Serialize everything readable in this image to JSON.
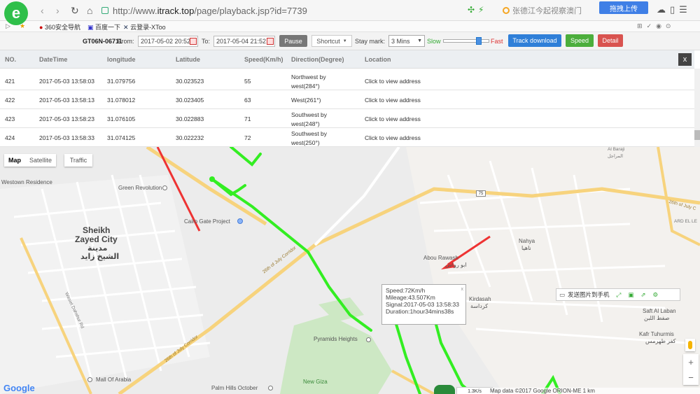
{
  "browser": {
    "logo": "e",
    "url_prefix": "http://www.",
    "url_domain": "itrack.top",
    "url_suffix": "/page/playback.jsp?id=7739",
    "search_text": "张德江今起视察澳门",
    "upload_label": "拖拽上传"
  },
  "bookmarks": [
    {
      "label": "360安全导航"
    },
    {
      "label": "百度一下"
    },
    {
      "label": "云登录-XToo"
    }
  ],
  "toolbar": {
    "device": "GT06N-06711",
    "from_label": "From:",
    "from_value": "2017-05-02 20:52",
    "to_label": "To:",
    "to_value": "2017-05-04 21:52",
    "pause_label": "Pause",
    "shortcut_label": "Shortcut",
    "staymark_label": "Stay mark:",
    "staymark_value": "3 Mins",
    "slow_label": "Slow",
    "fast_label": "Fast",
    "track_download_label": "Track download",
    "speed_label": "Speed",
    "detail_label": "Detail",
    "colors": {
      "track_download": "#2f7fd8",
      "speed": "#4cae3c",
      "detail": "#d9534f"
    }
  },
  "table": {
    "headers": [
      "NO.",
      "DateTime",
      "longitude",
      "Latitude",
      "Speed(Km/h)",
      "Direction(Degree)",
      "Location"
    ],
    "close_label": "x",
    "rows": [
      {
        "no": "421",
        "datetime": "2017-05-03 13:58:03",
        "lng": "31.079756",
        "lat": "30.023523",
        "speed": "55",
        "dir": "Northwest by west(284°)",
        "loc": "Click to view address"
      },
      {
        "no": "422",
        "datetime": "2017-05-03 13:58:13",
        "lng": "31.078012",
        "lat": "30.023405",
        "speed": "63",
        "dir": "West(261°)",
        "loc": "Click to view address"
      },
      {
        "no": "423",
        "datetime": "2017-05-03 13:58:23",
        "lng": "31.076105",
        "lat": "30.022883",
        "speed": "71",
        "dir": "Southwest by west(248°)",
        "loc": "Click to view address"
      },
      {
        "no": "424",
        "datetime": "2017-05-03 13:58:33",
        "lng": "31.074125",
        "lat": "30.022232",
        "speed": "72",
        "dir": "Southwest by west(250°)",
        "loc": "Click to view address"
      }
    ]
  },
  "map": {
    "tabs": {
      "map": "Map",
      "satellite": "Satellite",
      "traffic": "Traffic"
    },
    "labels": {
      "westown": "Westown Residence",
      "green_revolution": "Green Revolution",
      "cairo_gate": "Cairo Gate Project",
      "sheikh1": "Sheikh",
      "sheikh2": "Zayed City",
      "sheikh_ar1": "مدينة",
      "sheikh_ar2": "الشيخ زايد",
      "abou_rawash": "Abou Rawash",
      "abou_rawash_ar": "ابو رواش",
      "nahya": "Nahya",
      "nahya_ar": "ناهيا",
      "kirdasah": "Kirdasah",
      "kirdasah_ar": "كرداسة",
      "pyramids": "Pyramids Heights",
      "mall": "Mall Of Arabia",
      "palm": "Palm Hills October",
      "new_giza": "New Giza",
      "saft": "Saft Al Laban",
      "saft_ar": "صفط اللبن",
      "kafr": "Kafr Tuhurmis",
      "kafr_ar": "كفر طهرمس",
      "ard": "ARD EL LE",
      "al_baraji": "Al Baraji",
      "al_baraji_ar": "المراجل",
      "corridor": "26th of July Corridor",
      "corridor2": "26th of July Corridor",
      "corridor_right": "26th of July C",
      "wasiet": "Wasiet Dahshur Rd",
      "road75": "75"
    },
    "popup": {
      "speed": "Speed:72Km/h",
      "mileage": "Mileage:43.507Km",
      "signal": "Signal:2017-05-03 13:58:33",
      "duration": "Duration:1hour34mins38s",
      "close": "x"
    },
    "side_tools_label": "发送图片到手机",
    "zoom_in": "+",
    "zoom_out": "−",
    "attribution": "Map data ©2017 Google ORION-ME   1 km",
    "google": "Google",
    "kbps": "1.3K/s",
    "track_color": "#33ee22"
  }
}
